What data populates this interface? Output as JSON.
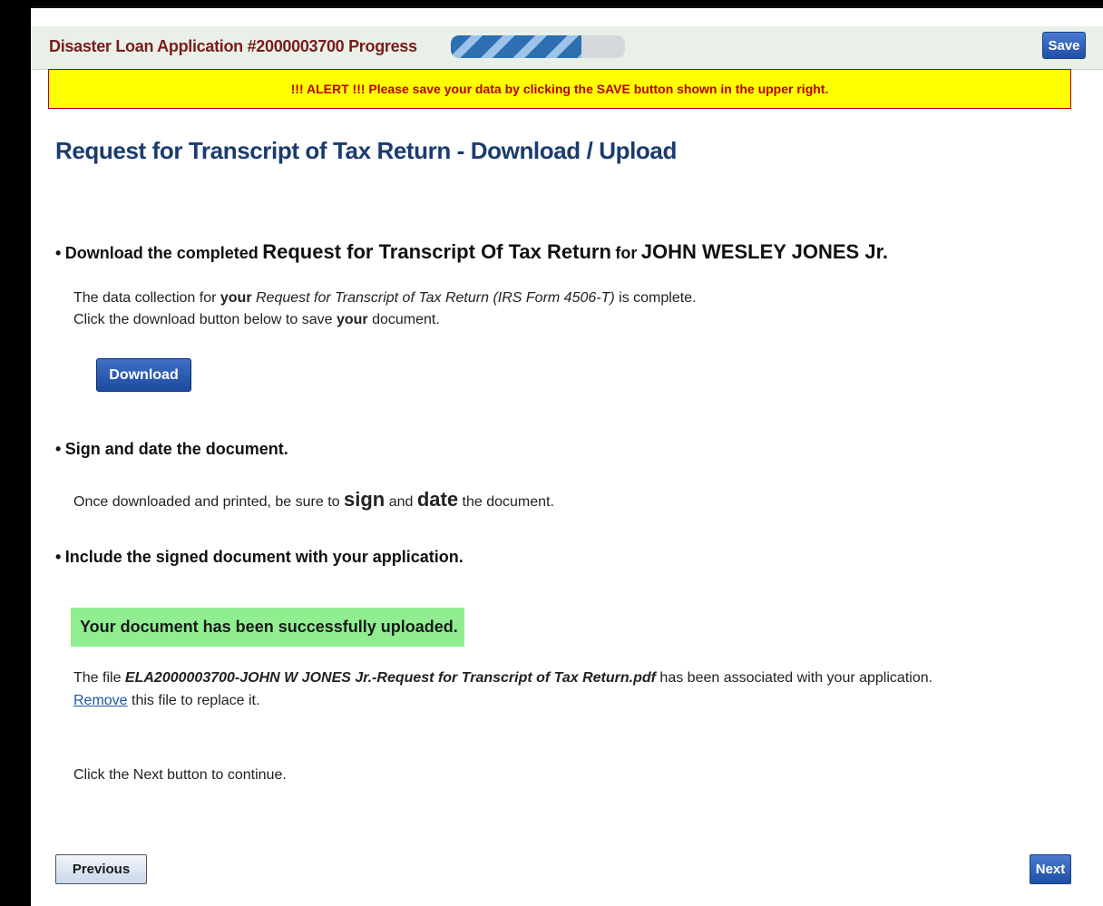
{
  "header": {
    "app_title": "Disaster Loan Application #2000003700",
    "progress_label": "Progress",
    "progress_fraction": 0.75,
    "save_label": "Save"
  },
  "alert": {
    "text": "!!! ALERT !!! Please save your data by clicking the SAVE button shown in the upper right."
  },
  "page_title": "Request for Transcript of Tax Return - Download / Upload",
  "step1": {
    "bullet": "•",
    "prefix": "Download the completed",
    "doc_name": "Request for Transcript Of Tax Return",
    "for_word": "for",
    "person": "JOHN WESLEY JONES Jr.",
    "line1_a": "The data collection for",
    "line1_b": "your",
    "line1_c": "Request for Transcript of Tax Return (IRS Form 4506-T)",
    "line1_d": "is complete.",
    "line2_a": "Click the download button below to save",
    "line2_b": "your",
    "line2_c": "document.",
    "download_label": "Download"
  },
  "step2": {
    "bullet": "•",
    "heading": "Sign and date the document.",
    "text_a": "Once downloaded and printed, be sure to",
    "sign": "sign",
    "and": "and",
    "date": "date",
    "text_b": "the document."
  },
  "step3": {
    "bullet": "•",
    "heading": "Include the signed document with your application.",
    "success": "Your document has been successfully uploaded.",
    "file_a": "The file",
    "file_name": "ELA2000003700-JOHN W JONES Jr.-Request for Transcript of Tax Return.pdf",
    "file_b": "has been associated with your application.",
    "remove_link": "Remove",
    "remove_rest": "this file to replace it.",
    "continue": "Click the Next button to continue."
  },
  "nav": {
    "previous_label": "Previous",
    "next_label": "Next"
  }
}
